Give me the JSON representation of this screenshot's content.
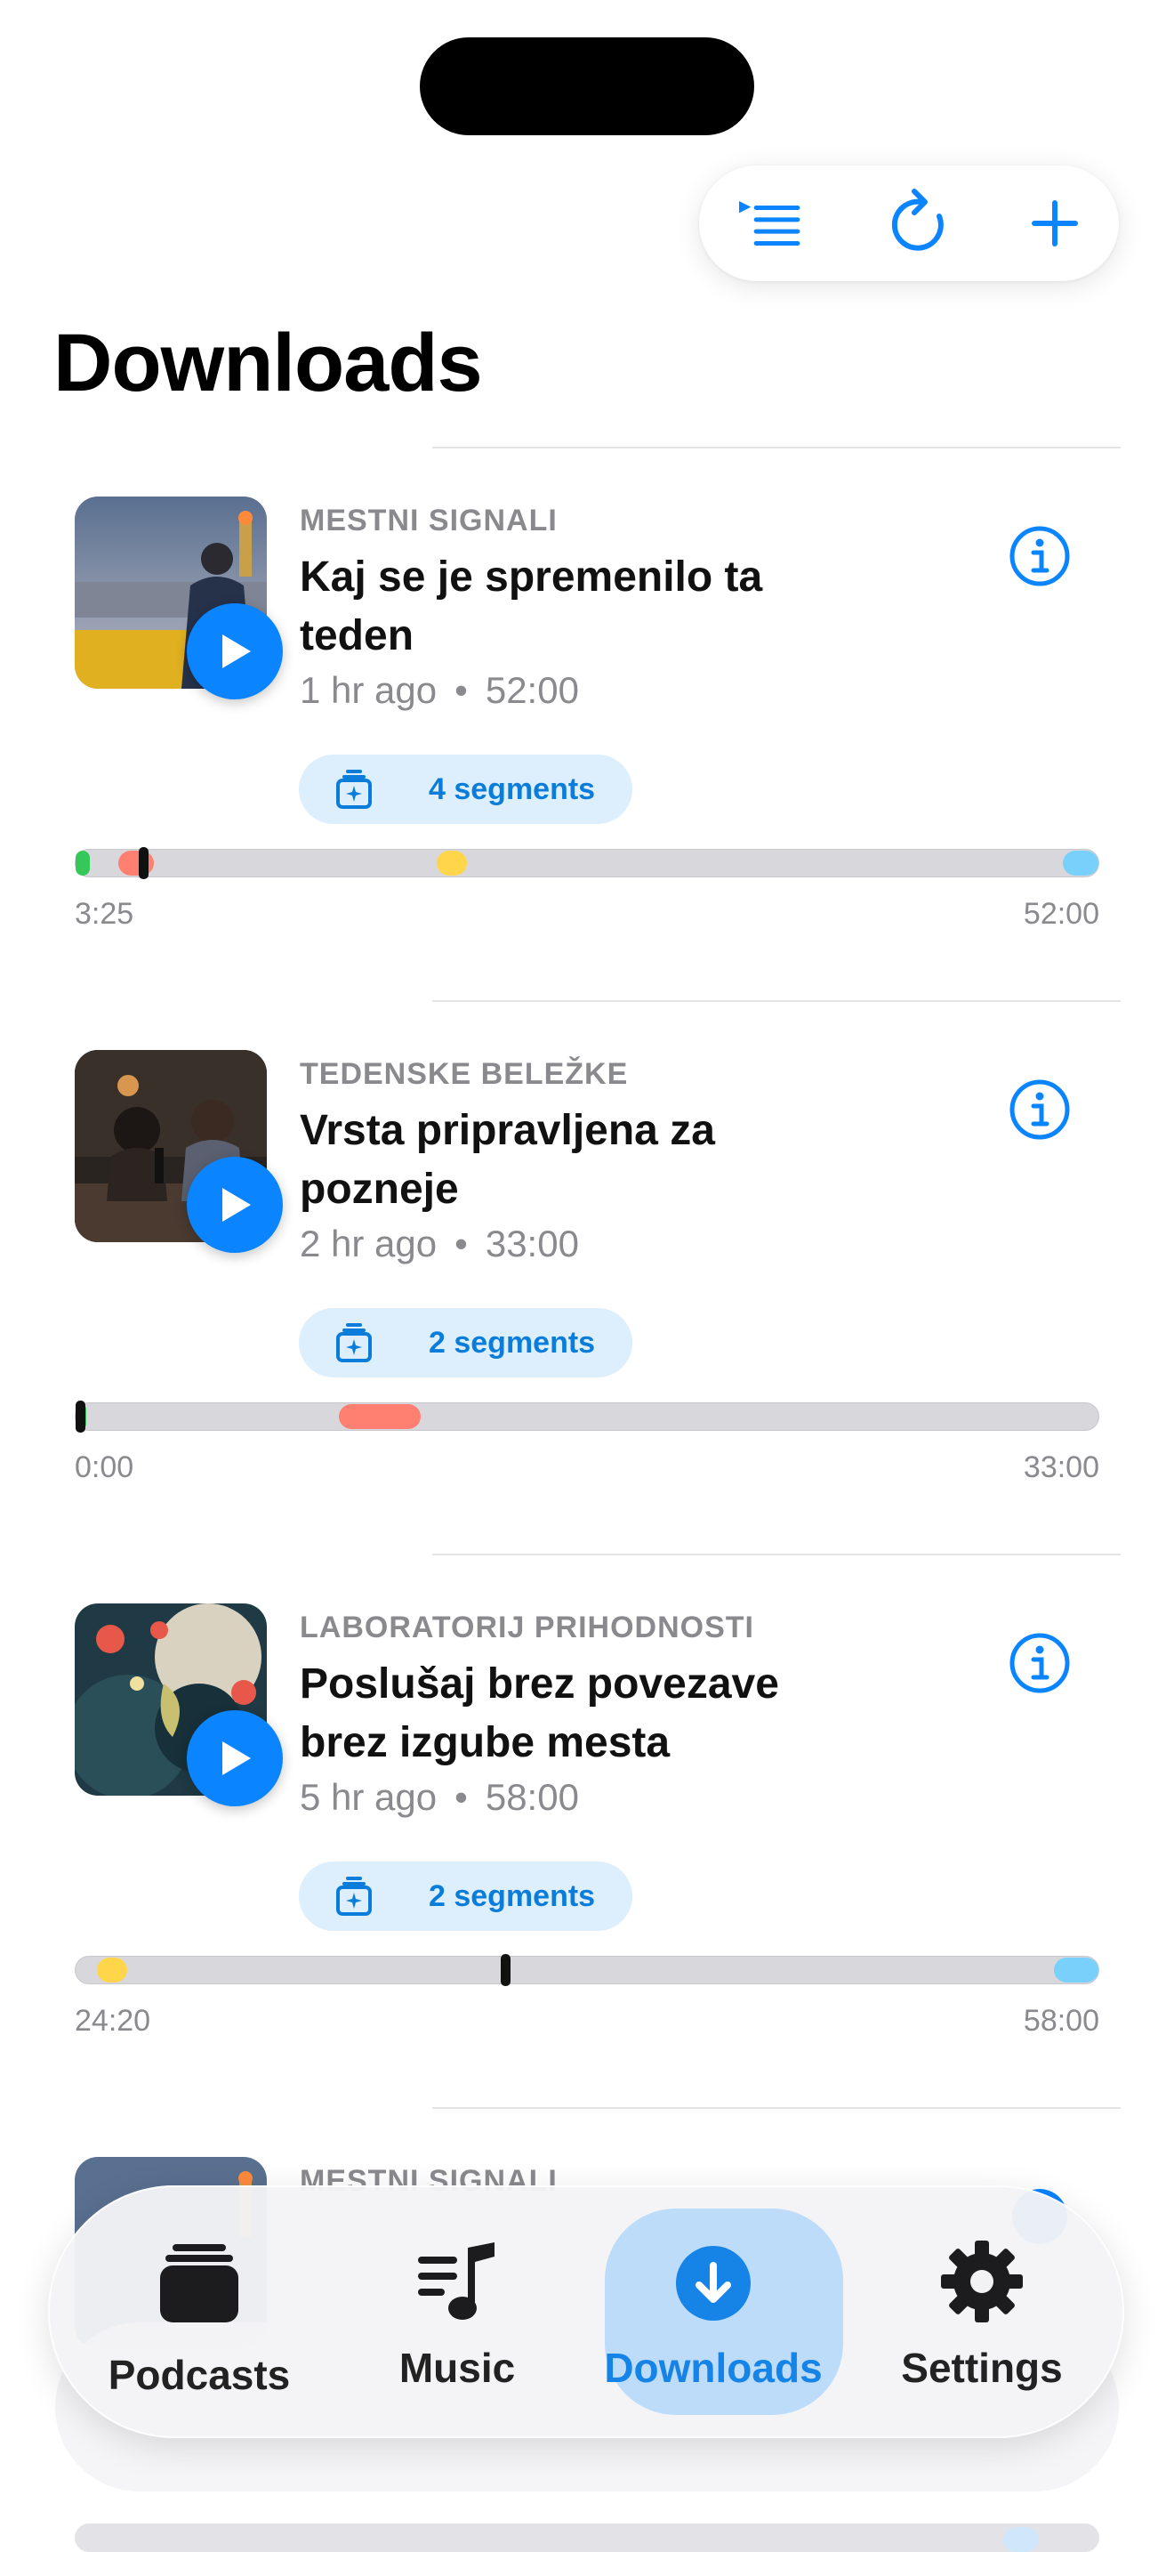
{
  "toolbar": {
    "icons": [
      "play-queue-icon",
      "refresh-icon",
      "add-icon"
    ]
  },
  "page": {
    "title": "Downloads"
  },
  "episodes": [
    {
      "show": "MESTNI SIGNALI",
      "title": "Kaj se je spremenilo ta teden",
      "ago": "1 hr ago",
      "duration": "52:00",
      "segments_label": "4 segments",
      "position_label": "3:25",
      "end_label": "52:00",
      "progress_fraction": 0.066,
      "segment_colors": [
        "#34c759",
        "#ff6b5a",
        "#ffd54a",
        "#5ac8fa"
      ]
    },
    {
      "show": "TEDENSKE BELEŽKE",
      "title": "Vrsta pripravljena za pozneje",
      "ago": "2 hr ago",
      "duration": "33:00",
      "segments_label": "2 segments",
      "position_label": "0:00",
      "end_label": "33:00",
      "progress_fraction": 0.0,
      "segment_colors": [
        "#34c759",
        "#ff6b5a"
      ]
    },
    {
      "show": "LABORATORIJ PRIHODNOSTI",
      "title": "Poslušaj brez povezave brez izgube mesta",
      "ago": "5 hr ago",
      "duration": "58:00",
      "segments_label": "2 segments",
      "position_label": "24:20",
      "end_label": "58:00",
      "progress_fraction": 0.42,
      "segment_colors": [
        "#ffd54a",
        "#5ac8fa"
      ]
    },
    {
      "show": "MESTNI SIGNALI"
    }
  ],
  "tabbar": {
    "tabs": [
      {
        "label": "Podcasts",
        "icon": "podcasts-stack-icon",
        "active": false
      },
      {
        "label": "Music",
        "icon": "music-note-icon",
        "active": false
      },
      {
        "label": "Downloads",
        "icon": "download-arrow-icon",
        "active": true
      },
      {
        "label": "Settings",
        "icon": "gear-icon",
        "active": false
      }
    ]
  },
  "colors": {
    "accent": "#0a84ff",
    "pill_bg": "#ddeefc",
    "track": "#d8d8dc"
  }
}
